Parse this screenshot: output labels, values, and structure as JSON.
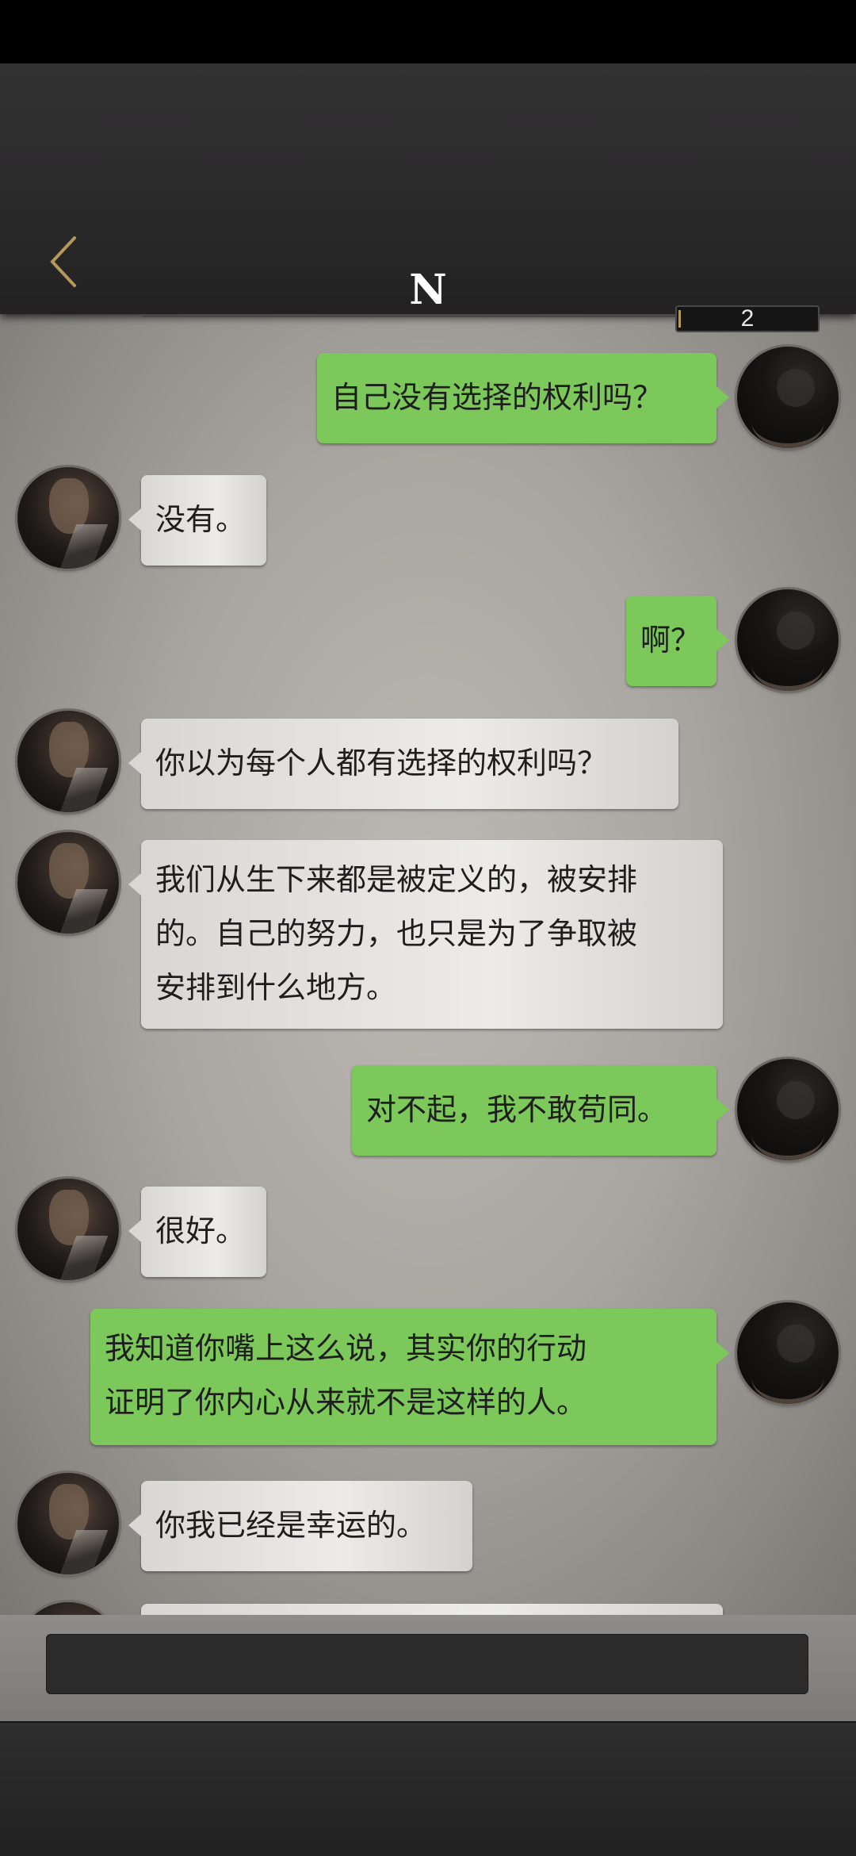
{
  "header": {
    "title": "N",
    "counter": "2"
  },
  "messages": [
    {
      "side": "me",
      "lines": [
        "自己没有选择的权利吗？"
      ]
    },
    {
      "side": "n",
      "lines": [
        "没有。"
      ]
    },
    {
      "side": "me",
      "lines": [
        "啊？"
      ]
    },
    {
      "side": "n",
      "lines": [
        "你以为每个人都有选择的权利吗？"
      ]
    },
    {
      "side": "n",
      "lines": [
        "我们从生下来都是被定义的，被安排",
        "的。自己的努力，也只是为了争取被",
        "安排到什么地方。"
      ]
    },
    {
      "side": "me",
      "lines": [
        "对不起，我不敢苟同。"
      ]
    },
    {
      "side": "n",
      "lines": [
        "很好。"
      ]
    },
    {
      "side": "me",
      "lines": [
        "我知道你嘴上这么说，其实你的行动",
        "证明了你内心从来就不是这样的人。"
      ]
    },
    {
      "side": "n",
      "lines": [
        "你我已经是幸运的。"
      ]
    }
  ],
  "icons": {
    "back": "chevron-left-icon",
    "accent": "#b49a5a",
    "me_bubble": "#7cc85a",
    "n_bubble": "#e6e4e1"
  }
}
